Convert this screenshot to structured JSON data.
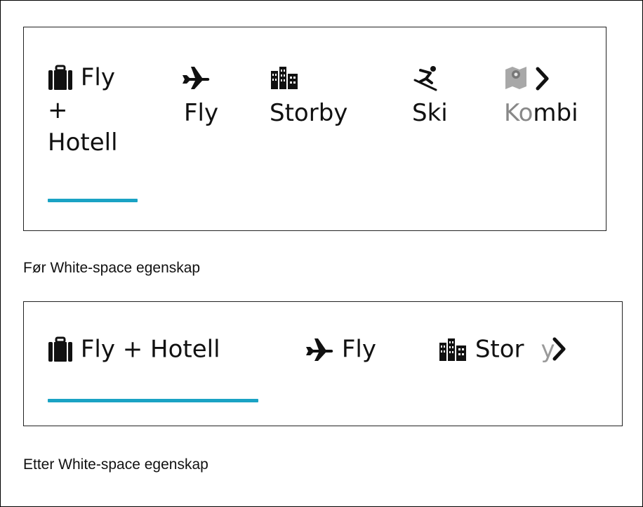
{
  "colors": {
    "accent": "#1aa3c4",
    "text": "#111111",
    "faded": "#8c8c8c"
  },
  "before": {
    "caption": "Før White-space egenskap",
    "tabs": [
      {
        "icon": "suitcase-icon",
        "label_line1": "Fly",
        "label_line2": "+",
        "label_line3": "Hotell",
        "selected": true
      },
      {
        "icon": "airplane-icon",
        "label": "Fly"
      },
      {
        "icon": "city-icon",
        "label": "Storby"
      },
      {
        "icon": "skier-icon",
        "label": "Ski"
      },
      {
        "icon": "map-pin-icon",
        "label_start": "Ko",
        "label_end": "mbi"
      }
    ]
  },
  "after": {
    "caption": "Etter White-space egenskap",
    "tabs": [
      {
        "icon": "suitcase-icon",
        "label": "Fly + Hotell",
        "selected": true
      },
      {
        "icon": "airplane-icon",
        "label": "Fly"
      },
      {
        "icon": "city-icon",
        "label_start": "Stor",
        "label_end": "y"
      }
    ]
  },
  "scroll_icon": "chevron-right-icon"
}
